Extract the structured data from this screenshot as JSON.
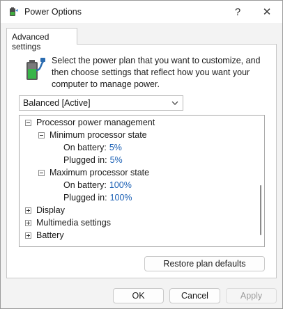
{
  "window": {
    "title": "Power Options",
    "help_glyph": "?",
    "close_glyph": "✕"
  },
  "tab": {
    "label": "Advanced settings"
  },
  "description": "Select the power plan that you want to customize, and then choose settings that reflect how you want your computer to manage power.",
  "plan_select": {
    "value": "Balanced [Active]"
  },
  "tree": {
    "processor": {
      "label": "Processor power management",
      "min_state": {
        "label": "Minimum processor state",
        "on_battery_label": "On battery:",
        "on_battery_value": "5%",
        "plugged_in_label": "Plugged in:",
        "plugged_in_value": "5%"
      },
      "max_state": {
        "label": "Maximum processor state",
        "on_battery_label": "On battery:",
        "on_battery_value": "100%",
        "plugged_in_label": "Plugged in:",
        "plugged_in_value": "100%"
      }
    },
    "display": {
      "label": "Display"
    },
    "multimedia": {
      "label": "Multimedia settings"
    },
    "battery": {
      "label": "Battery"
    }
  },
  "buttons": {
    "restore": "Restore plan defaults",
    "ok": "OK",
    "cancel": "Cancel",
    "apply": "Apply"
  },
  "colors": {
    "link": "#1a5fb4",
    "disabled_text": "#9a9a9a"
  },
  "icons": {
    "app": "power-options-icon",
    "battery": "battery-plug-icon",
    "chevron": "chevron-down-icon"
  }
}
